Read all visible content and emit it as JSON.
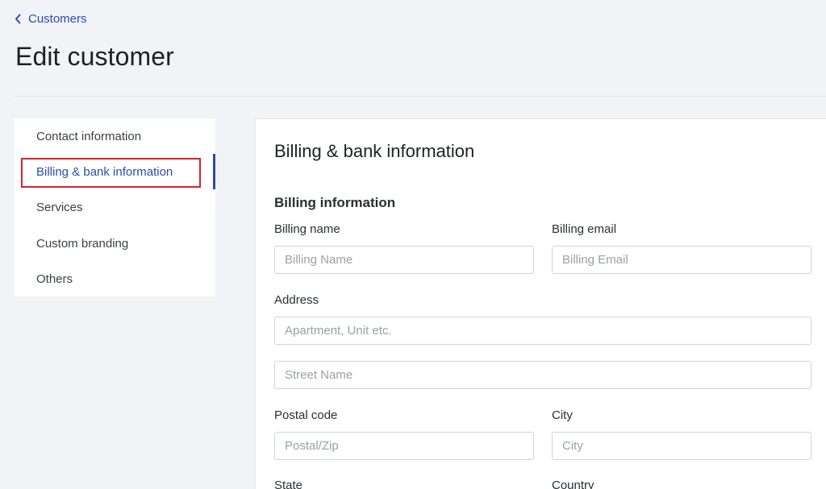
{
  "breadcrumb": {
    "back_label": "Customers"
  },
  "page_title": "Edit customer",
  "side_nav": {
    "items": [
      {
        "label": "Contact information"
      },
      {
        "label": "Billing & bank information"
      },
      {
        "label": "Services"
      },
      {
        "label": "Custom branding"
      },
      {
        "label": "Others"
      }
    ],
    "active_index": 1
  },
  "card": {
    "title": "Billing & bank information",
    "section_title": "Billing information",
    "fields": {
      "billing_name": {
        "label": "Billing name",
        "value": "",
        "placeholder": "Billing Name"
      },
      "billing_email": {
        "label": "Billing email",
        "value": "",
        "placeholder": "Billing Email"
      },
      "address": {
        "label": "Address",
        "line1_placeholder": "Apartment, Unit etc.",
        "line2_placeholder": "Street Name"
      },
      "postal_code": {
        "label": "Postal code",
        "value": "",
        "placeholder": "Postal/Zip"
      },
      "city": {
        "label": "City",
        "value": "",
        "placeholder": "City"
      },
      "state": {
        "label": "State"
      },
      "country": {
        "label": "Country"
      }
    }
  },
  "colors": {
    "accent": "#2b4bb0",
    "highlight": "#d8232a",
    "background": "#f2f3f7"
  }
}
